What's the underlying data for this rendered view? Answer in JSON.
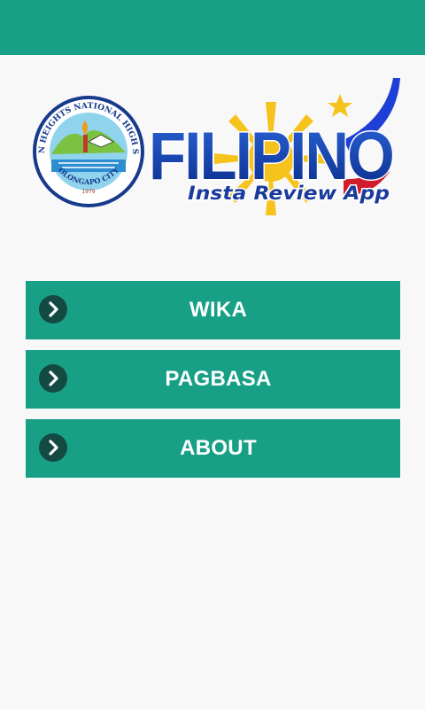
{
  "app": {
    "brand_color": "#17a086",
    "background_color": "#f8f8f8"
  },
  "logo": {
    "seal_text_top": "GORDON HEIGHTS NATIONAL HIGH SCHOOL",
    "seal_text_bottom": "OLONGAPO CITY",
    "seal_year": "1979",
    "title": "FILIPINO",
    "subtitle": "Insta Review App"
  },
  "menu": {
    "items": [
      {
        "label": "WIKA",
        "icon": "chevron-right-icon"
      },
      {
        "label": "PAGBASA",
        "icon": "chevron-right-icon"
      },
      {
        "label": "ABOUT",
        "icon": "chevron-right-icon"
      }
    ]
  }
}
